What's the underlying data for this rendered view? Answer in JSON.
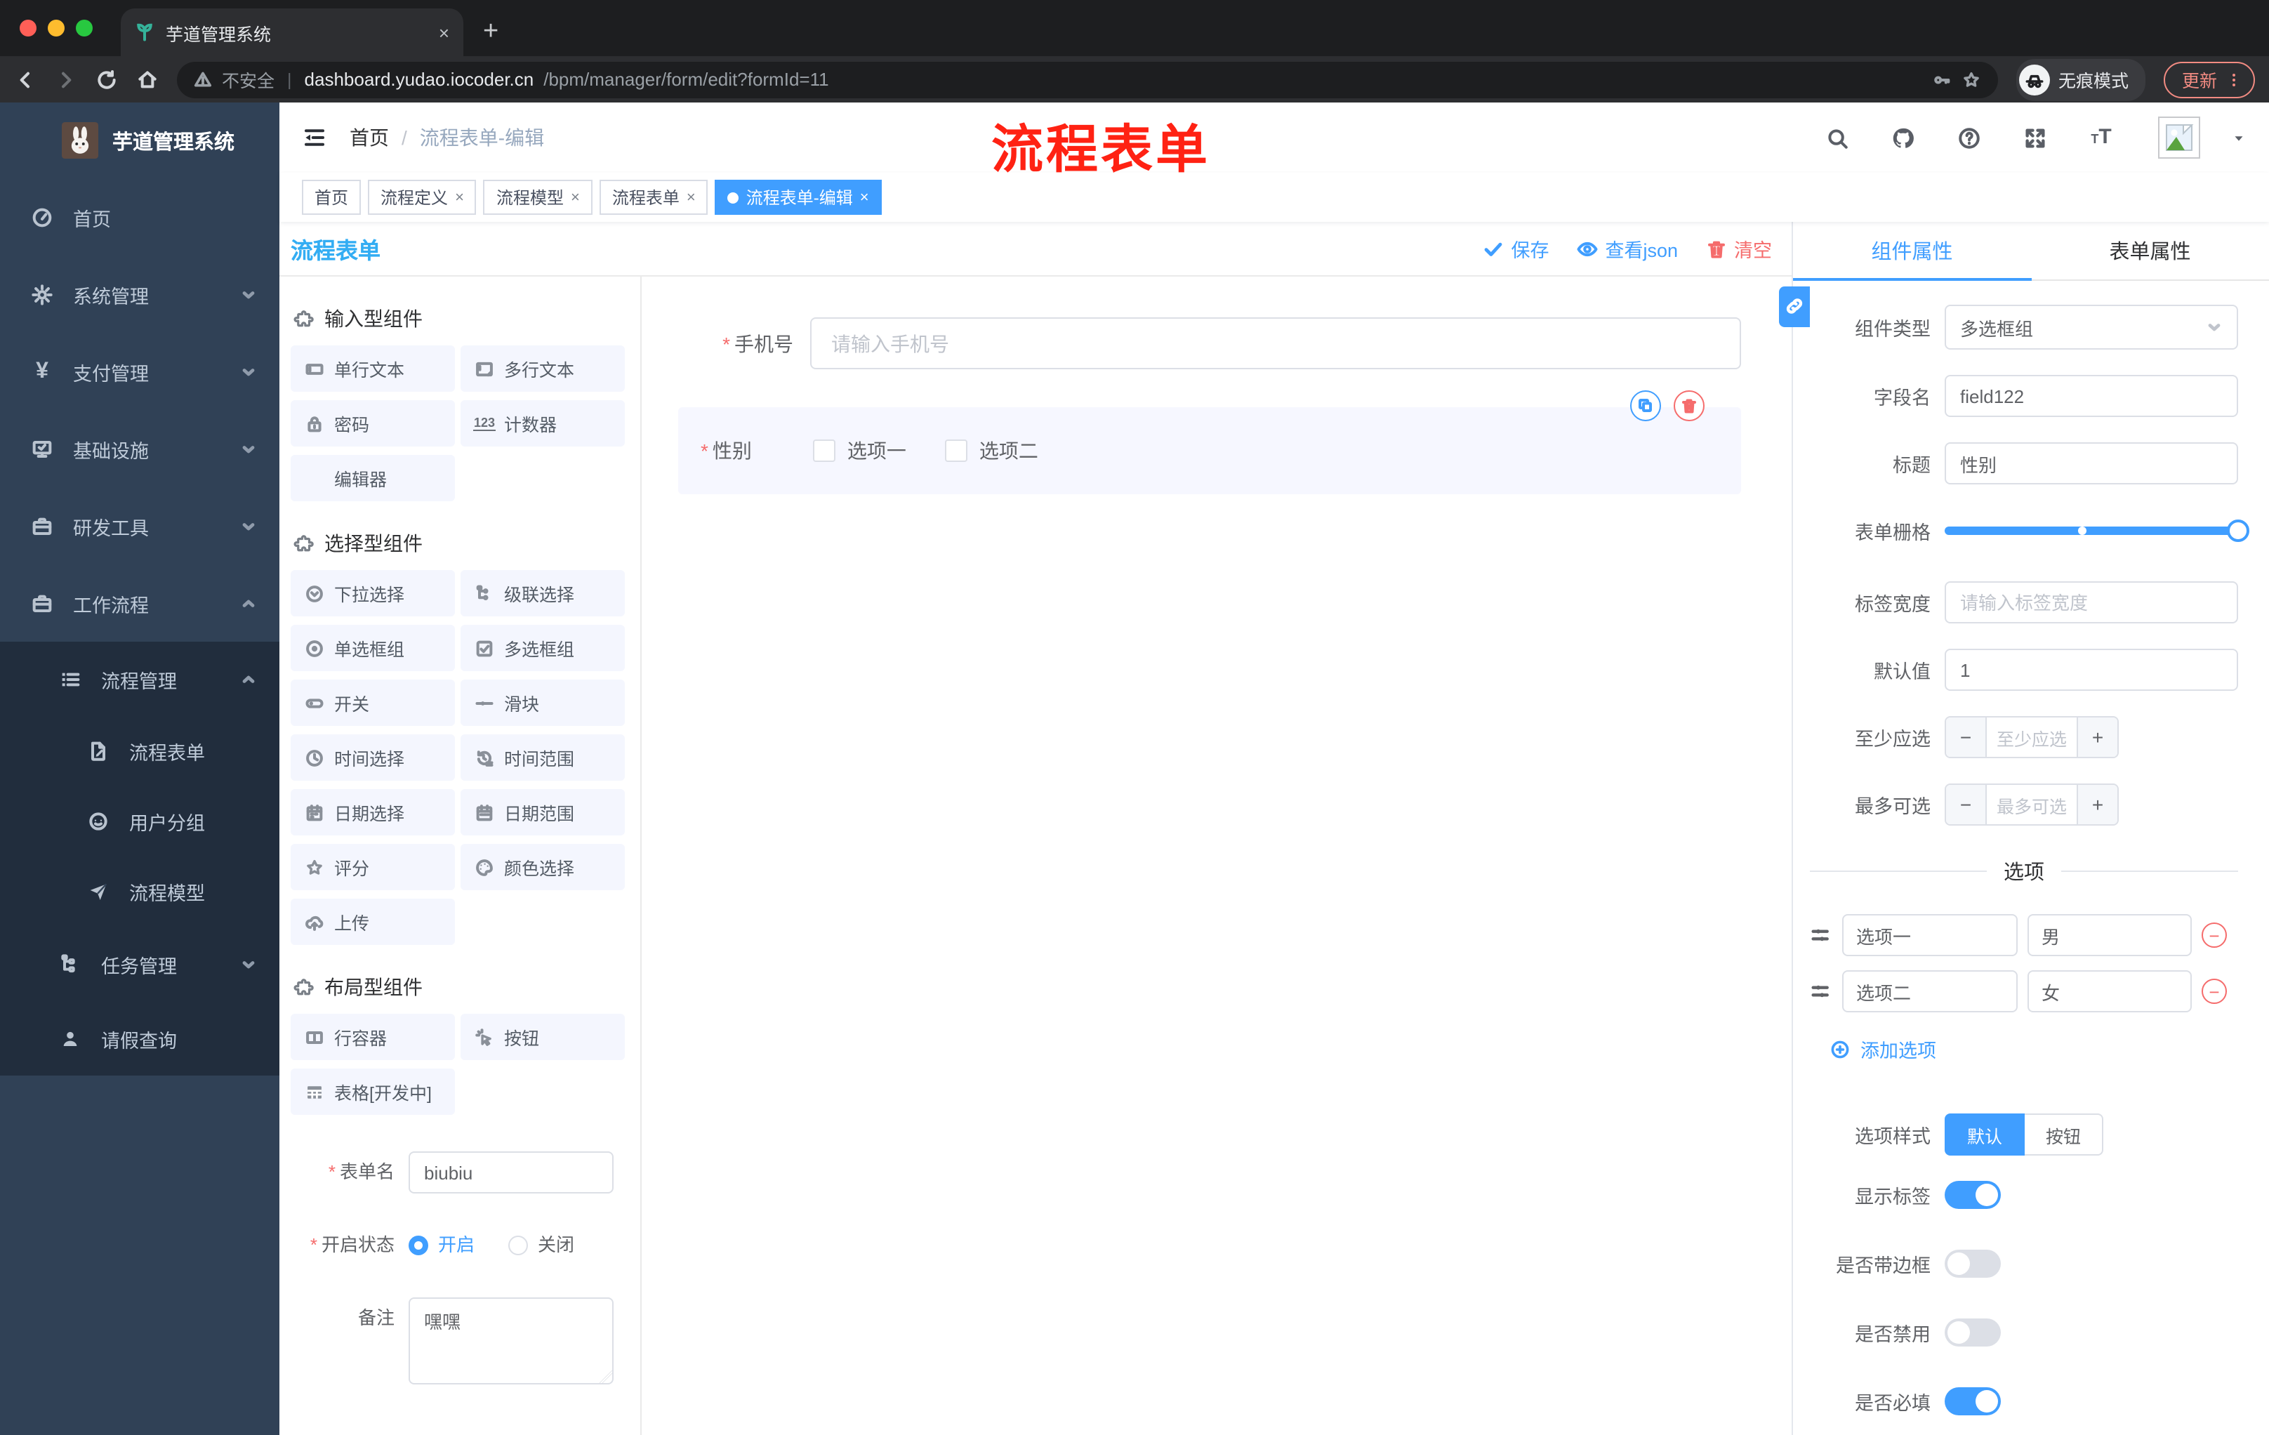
{
  "colors": {
    "accent": "#409eff",
    "danger": "#f56c6c",
    "annotation_red": "#ff2213",
    "sidebar_bg": "#304156",
    "canvas_title_blue": "#33adf3"
  },
  "browser": {
    "tab": {
      "favicon": "sprout-icon",
      "title": "芋道管理系统",
      "close": "×"
    },
    "address": {
      "security": "不安全",
      "host": "dashboard.yudao.iocoder.cn",
      "path": "/bpm/manager/form/edit?formId=11"
    },
    "incognito_label": "无痕模式",
    "update_label": "更新"
  },
  "sidebar": {
    "brand": "芋道管理系统",
    "items": [
      {
        "label": "首页",
        "icon": "dashboard"
      },
      {
        "label": "系统管理",
        "icon": "gear",
        "chevron": "down"
      },
      {
        "label": "支付管理",
        "icon": "yen",
        "chevron": "down"
      },
      {
        "label": "基础设施",
        "icon": "infra",
        "chevron": "down"
      },
      {
        "label": "研发工具",
        "icon": "toolbox",
        "chevron": "down"
      },
      {
        "label": "工作流程",
        "icon": "toolbox",
        "chevron": "up"
      }
    ],
    "sub": {
      "title": "流程管理",
      "icon": "worklist",
      "chevron": "up",
      "children": [
        {
          "label": "流程表单",
          "icon": "docedit"
        },
        {
          "label": "用户分组",
          "icon": "face"
        },
        {
          "label": "流程模型",
          "icon": "plane"
        }
      ],
      "tail": [
        {
          "label": "任务管理",
          "icon": "tree",
          "chevron": "down"
        },
        {
          "label": "请假查询",
          "icon": "person"
        }
      ]
    }
  },
  "header": {
    "breadcrumb": [
      "首页",
      "流程表单-编辑"
    ],
    "separator": "/",
    "annotation": "流程表单"
  },
  "tags": [
    {
      "label": "首页",
      "closable": false,
      "active": false
    },
    {
      "label": "流程定义",
      "closable": true,
      "active": false
    },
    {
      "label": "流程模型",
      "closable": true,
      "active": false
    },
    {
      "label": "流程表单",
      "closable": true,
      "active": false
    },
    {
      "label": "流程表单-编辑",
      "closable": true,
      "active": true
    }
  ],
  "designer": {
    "title": "流程表单",
    "toolbar": {
      "save": "保存",
      "view_json": "查看json",
      "clear": "清空"
    },
    "palette": {
      "sections": [
        {
          "title": "输入型组件",
          "items": [
            {
              "label": "单行文本",
              "icon": "input"
            },
            {
              "label": "多行文本",
              "icon": "textarea"
            },
            {
              "label": "密码",
              "icon": "lock"
            },
            {
              "label": "计数器",
              "icon": "counter"
            },
            {
              "label": "编辑器",
              "icon": "none"
            }
          ]
        },
        {
          "title": "选择型组件",
          "items": [
            {
              "label": "下拉选择",
              "icon": "selectic"
            },
            {
              "label": "级联选择",
              "icon": "cascader"
            },
            {
              "label": "单选框组",
              "icon": "radio"
            },
            {
              "label": "多选框组",
              "icon": "checkbox"
            },
            {
              "label": "开关",
              "icon": "switchic"
            },
            {
              "label": "滑块",
              "icon": "slideric"
            },
            {
              "label": "时间选择",
              "icon": "time"
            },
            {
              "label": "时间范围",
              "icon": "timerange"
            },
            {
              "label": "日期选择",
              "icon": "date"
            },
            {
              "label": "日期范围",
              "icon": "daterange"
            },
            {
              "label": "评分",
              "icon": "star"
            },
            {
              "label": "颜色选择",
              "icon": "palettei"
            },
            {
              "label": "上传",
              "icon": "upload"
            }
          ]
        },
        {
          "title": "布局型组件",
          "items": [
            {
              "label": "行容器",
              "icon": "rowic"
            },
            {
              "label": "按钮",
              "icon": "buttonic"
            },
            {
              "label": "表格[开发中]",
              "icon": "tableic"
            }
          ]
        }
      ]
    },
    "form": {
      "name_label": "表单名",
      "name_value": "biubiu",
      "status_label": "开启状态",
      "status_on": "开启",
      "status_off": "关闭",
      "status_selected": "开启",
      "remark_label": "备注",
      "remark_value": "嘿嘿"
    },
    "canvas": {
      "phone": {
        "label": "手机号",
        "placeholder": "请输入手机号"
      },
      "gender": {
        "label": "性别",
        "options": [
          "选项一",
          "选项二"
        ]
      }
    }
  },
  "props": {
    "tabs": {
      "component": "组件属性",
      "form": "表单属性",
      "active": "组件属性"
    },
    "fields": {
      "component_type_label": "组件类型",
      "component_type_value": "多选框组",
      "field_name_label": "字段名",
      "field_name_value": "field122",
      "title_label": "标题",
      "title_value": "性别",
      "grid_label": "表单栅格",
      "grid_mark_percent": 47,
      "grid_value_percent": 100,
      "label_width_label": "标签宽度",
      "label_width_placeholder": "请输入标签宽度",
      "default_label": "默认值",
      "default_value": "1",
      "min_label": "至少应选",
      "min_placeholder": "至少应选",
      "max_label": "最多可选",
      "max_placeholder": "最多可选"
    },
    "options": {
      "divider": "选项",
      "rows": [
        {
          "label": "选项一",
          "value": "男"
        },
        {
          "label": "选项二",
          "value": "女"
        }
      ],
      "add_label": "添加选项"
    },
    "style": {
      "label": "选项样式",
      "default_option": "默认",
      "button_option": "按钮",
      "selected": "默认"
    },
    "switches": [
      {
        "label": "显示标签",
        "on": true
      },
      {
        "label": "是否带边框",
        "on": false
      },
      {
        "label": "是否禁用",
        "on": false
      },
      {
        "label": "是否必填",
        "on": true
      }
    ]
  }
}
